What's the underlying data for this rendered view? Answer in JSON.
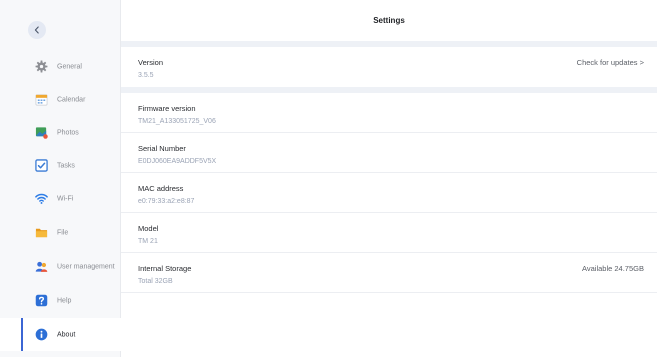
{
  "header": {
    "title": "Settings"
  },
  "sidebar": {
    "items": [
      {
        "label": "General",
        "icon": "gear-icon"
      },
      {
        "label": "Calendar",
        "icon": "calendar-icon"
      },
      {
        "label": "Photos",
        "icon": "photo-icon"
      },
      {
        "label": "Tasks",
        "icon": "checkbox-icon"
      },
      {
        "label": "Wi-Fi",
        "icon": "wifi-icon"
      },
      {
        "label": "File",
        "icon": "folder-icon"
      },
      {
        "label": "User management",
        "icon": "users-icon"
      },
      {
        "label": "Help",
        "icon": "help-icon"
      },
      {
        "label": "About",
        "icon": "info-icon",
        "active": true
      }
    ]
  },
  "about": {
    "version": {
      "title": "Version",
      "value": "3.5.5",
      "action": "Check for updates >"
    },
    "firmware": {
      "title": "Firmware version",
      "value": "TM21_A133051725_V06"
    },
    "serial": {
      "title": "Serial Number",
      "value": "E0DJ060EA9ADDF5V5X"
    },
    "mac": {
      "title": "MAC address",
      "value": "e0:79:33:a2:e8:87"
    },
    "model": {
      "title": "Model",
      "value": "TM 21"
    },
    "storage": {
      "title": "Internal Storage",
      "value": "Total 32GB",
      "available": "Available 24.75GB"
    }
  },
  "colors": {
    "accent": "#3b66d4",
    "sidebar_bg": "#f7f8fa",
    "separator": "#eef1f6"
  }
}
